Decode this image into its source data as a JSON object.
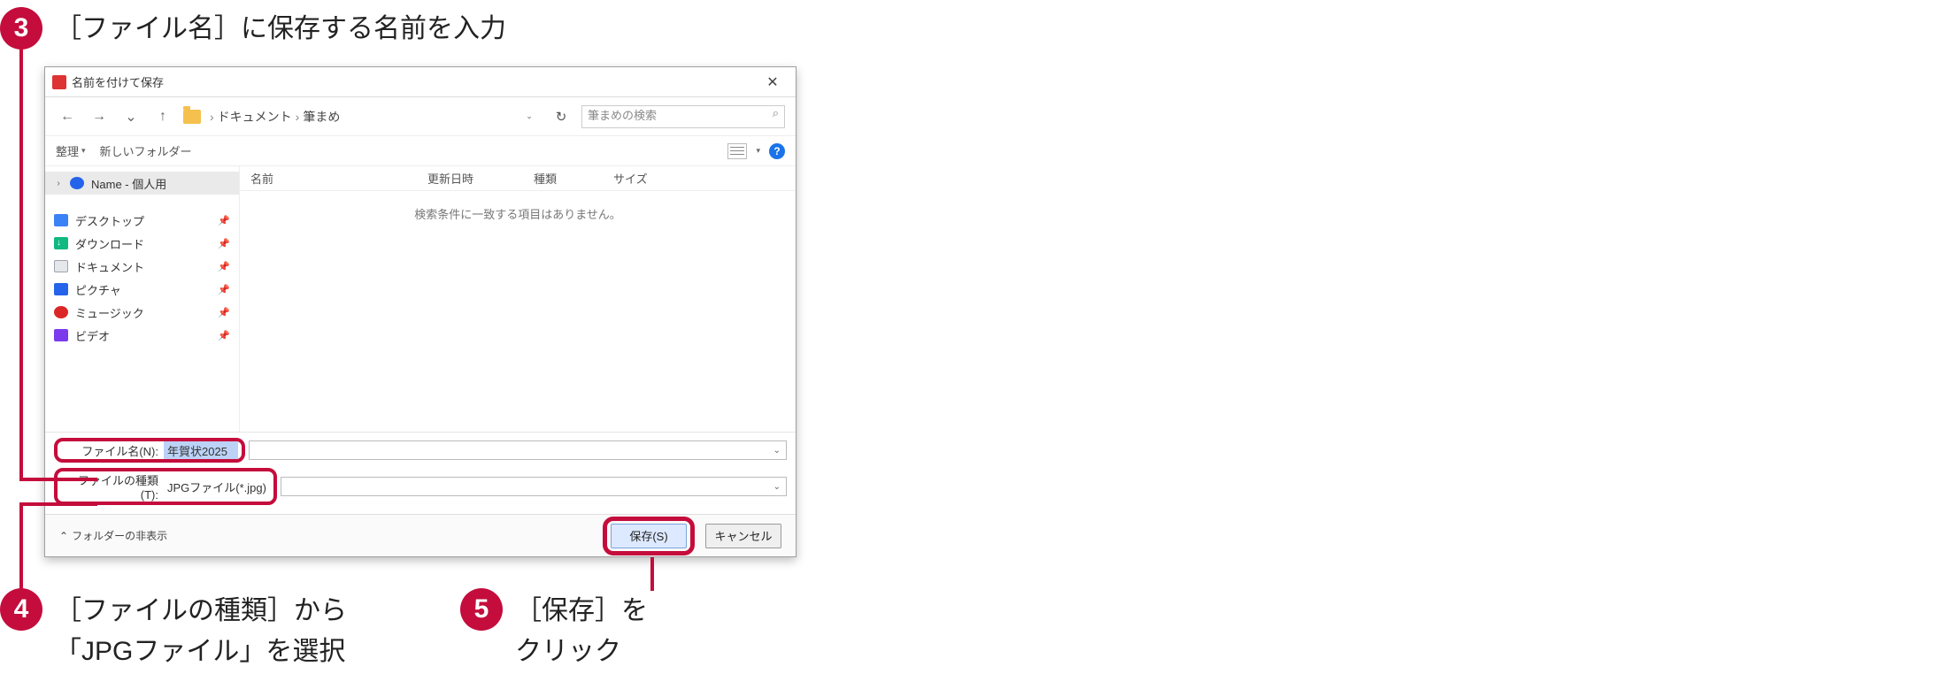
{
  "callouts": {
    "c3": {
      "num": "3",
      "text": "［ファイル名］に保存する名前を入力"
    },
    "c4": {
      "num": "4",
      "line1": "［ファイルの種類］から",
      "line2": "「JPGファイル」を選択"
    },
    "c5": {
      "num": "5",
      "line1": "［保存］を",
      "line2": "クリック"
    }
  },
  "dialog": {
    "title": "名前を付けて保存",
    "path": {
      "seg1": "ドキュメント",
      "seg2": "筆まめ"
    },
    "nav": {
      "dropdown_caret": "⌄",
      "refresh": "↻"
    },
    "search_placeholder": "筆まめの検索",
    "search_icon": "🔍",
    "toolbar": {
      "arrange": "整理",
      "newfolder": "新しいフォルダー"
    },
    "headers": {
      "name": "名前",
      "date": "更新日時",
      "type": "種類",
      "size": "サイズ"
    },
    "empty": "検索条件に一致する項目はありません。",
    "sidebar": {
      "root": "Name - 個人用",
      "items": [
        {
          "label": "デスクトップ",
          "color": "#3b82f6"
        },
        {
          "label": "ダウンロード",
          "color": "#10b981"
        },
        {
          "label": "ドキュメント",
          "color": "#6b7280"
        },
        {
          "label": "ピクチャ",
          "color": "#2563eb"
        },
        {
          "label": "ミュージック",
          "color": "#dc2626"
        },
        {
          "label": "ビデオ",
          "color": "#7c3aed"
        }
      ]
    },
    "fields": {
      "filename_label": "ファイル名(N):",
      "filename_value": "年賀状2025",
      "filetype_label": "ファイルの種類(T):",
      "filetype_value": "JPGファイル(*.jpg)"
    },
    "footer": {
      "fold": "フォルダーの非表示",
      "save": "保存(S)",
      "cancel": "キャンセル"
    }
  }
}
